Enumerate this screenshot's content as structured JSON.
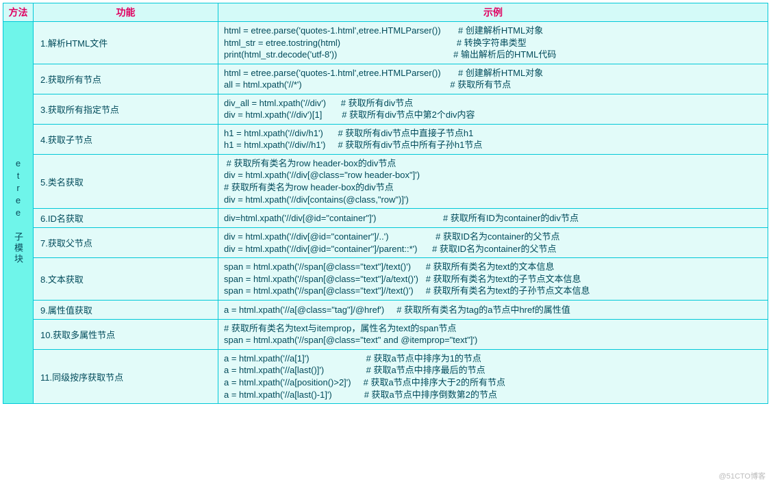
{
  "headers": {
    "method": "方法",
    "func": "功能",
    "example": "示例"
  },
  "sidebar": "etree 子模块",
  "rows": [
    {
      "func": "1.解析HTML文件",
      "ex": "html = etree.parse('quotes-1.html',etree.HTMLParser())       # 创建解析HTML对象\nhtml_str = etree.tostring(html)                                               # 转换字符串类型\nprint(html_str.decode('utf-8'))                                               # 输出解析后的HTML代码"
    },
    {
      "func": "2.获取所有节点",
      "ex": "html = etree.parse('quotes-1.html',etree.HTMLParser())       # 创建解析HTML对象\nall = html.xpath('//*')                                                            # 获取所有节点"
    },
    {
      "func": "3.获取所有指定节点",
      "ex": "div_all = html.xpath('//div')      # 获取所有div节点\ndiv = html.xpath('//div')[1]        # 获取所有div节点中第2个div内容"
    },
    {
      "func": "4.获取子节点",
      "ex": "h1 = html.xpath('//div/h1')      # 获取所有div节点中直接子节点h1\nh1 = html.xpath('//div//h1')     # 获取所有div节点中所有子孙h1节点"
    },
    {
      "func": "5.类名获取",
      "ex": " # 获取所有类名为row header-box的div节点\ndiv = html.xpath('//div[@class=\"row header-box\"]')\n# 获取所有类名为row header-box的div节点\ndiv = html.xpath('//div[contains(@class,\"row\")]')"
    },
    {
      "func": "6.ID名获取",
      "ex": "div=html.xpath('//div[@id=\"container\"]')                           # 获取所有ID为container的div节点"
    },
    {
      "func": "7.获取父节点",
      "ex": "div = html.xpath('//div[@id=\"container\"]/..')                   # 获取ID名为container的父节点\ndiv = html.xpath('//div[@id=\"container\"]/parent::*')      # 获取ID名为container的父节点"
    },
    {
      "func": "8.文本获取",
      "ex": "span = html.xpath('//span[@class=\"text\"]/text()')      # 获取所有类名为text的文本信息\nspan = html.xpath('//span[@class=\"text\"]/a/text()')   # 获取所有类名为text的子节点文本信息\nspan = html.xpath('//span[@class=\"text\"]//text()')     # 获取所有类名为text的子孙节点文本信息"
    },
    {
      "func": "9.属性值获取",
      "ex": "a = html.xpath('//a[@class=\"tag\"]/@href')     # 获取所有类名为tag的a节点中href的属性值"
    },
    {
      "func": "10.获取多属性节点",
      "ex": "# 获取所有类名为text与itemprop，属性名为text的span节点\nspan = html.xpath('//span[@class=\"text\" and @itemprop=\"text\"]')"
    },
    {
      "func": "11.同级按序获取节点",
      "ex": "a = html.xpath('//a[1]')                       # 获取a节点中排序为1的节点\na = html.xpath('//a[last()]')                 # 获取a节点中排序最后的节点\na = html.xpath('//a[position()>2]')     # 获取a节点中排序大于2的所有节点\na = html.xpath('//a[last()-1]')             # 获取a节点中排序倒数第2的节点"
    }
  ],
  "watermark": "@51CTO博客"
}
